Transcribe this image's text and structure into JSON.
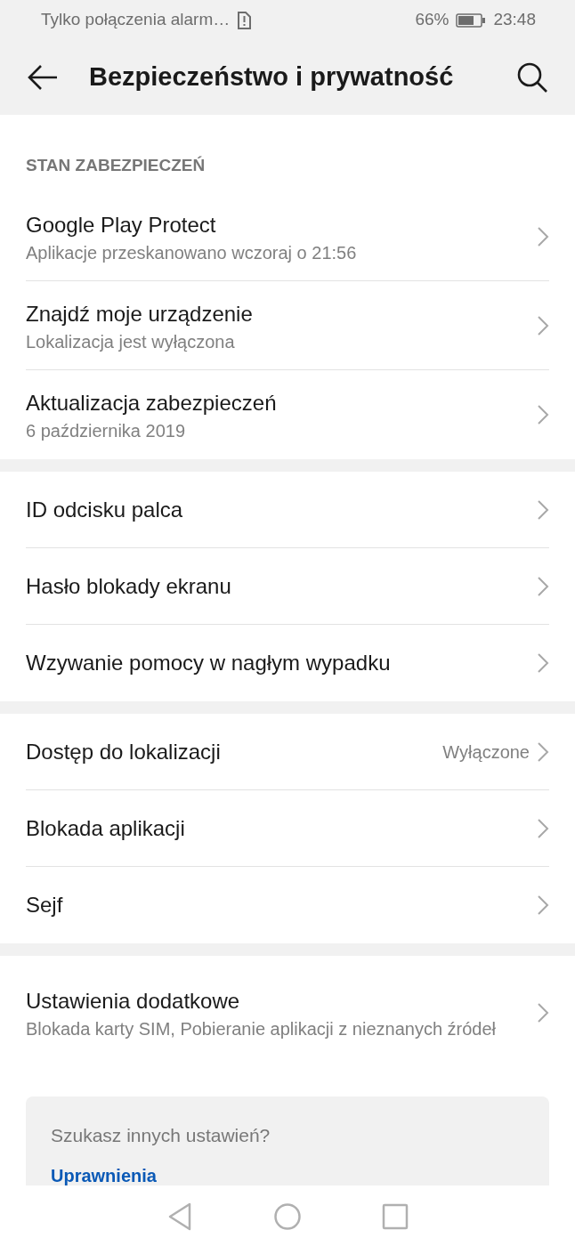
{
  "status_bar": {
    "carrier": "Tylko połączenia alarm…",
    "battery": "66%",
    "time": "23:48"
  },
  "header": {
    "title": "Bezpieczeństwo i prywatność"
  },
  "groups": [
    {
      "heading": "STAN ZABEZPIECZEŃ",
      "items": [
        {
          "title": "Google Play Protect",
          "subtitle": "Aplikacje przeskanowano wczoraj o 21:56"
        },
        {
          "title": "Znajdź moje urządzenie",
          "subtitle": "Lokalizacja jest wyłączona"
        },
        {
          "title": "Aktualizacja zabezpieczeń",
          "subtitle": "6 października 2019"
        }
      ]
    },
    {
      "items": [
        {
          "title": "ID odcisku palca"
        },
        {
          "title": "Hasło blokady ekranu"
        },
        {
          "title": "Wzywanie pomocy w nagłym wypadku"
        }
      ]
    },
    {
      "items": [
        {
          "title": "Dostęp do lokalizacji",
          "value": "Wyłączone"
        },
        {
          "title": "Blokada aplikacji"
        },
        {
          "title": "Sejf"
        }
      ]
    },
    {
      "items": [
        {
          "title": "Ustawienia dodatkowe",
          "subtitle": "Blokada karty SIM, Pobieranie aplikacji z nieznanych źródeł"
        }
      ]
    }
  ],
  "help_card": {
    "question": "Szukasz innych ustawień?",
    "link": "Uprawnienia"
  }
}
